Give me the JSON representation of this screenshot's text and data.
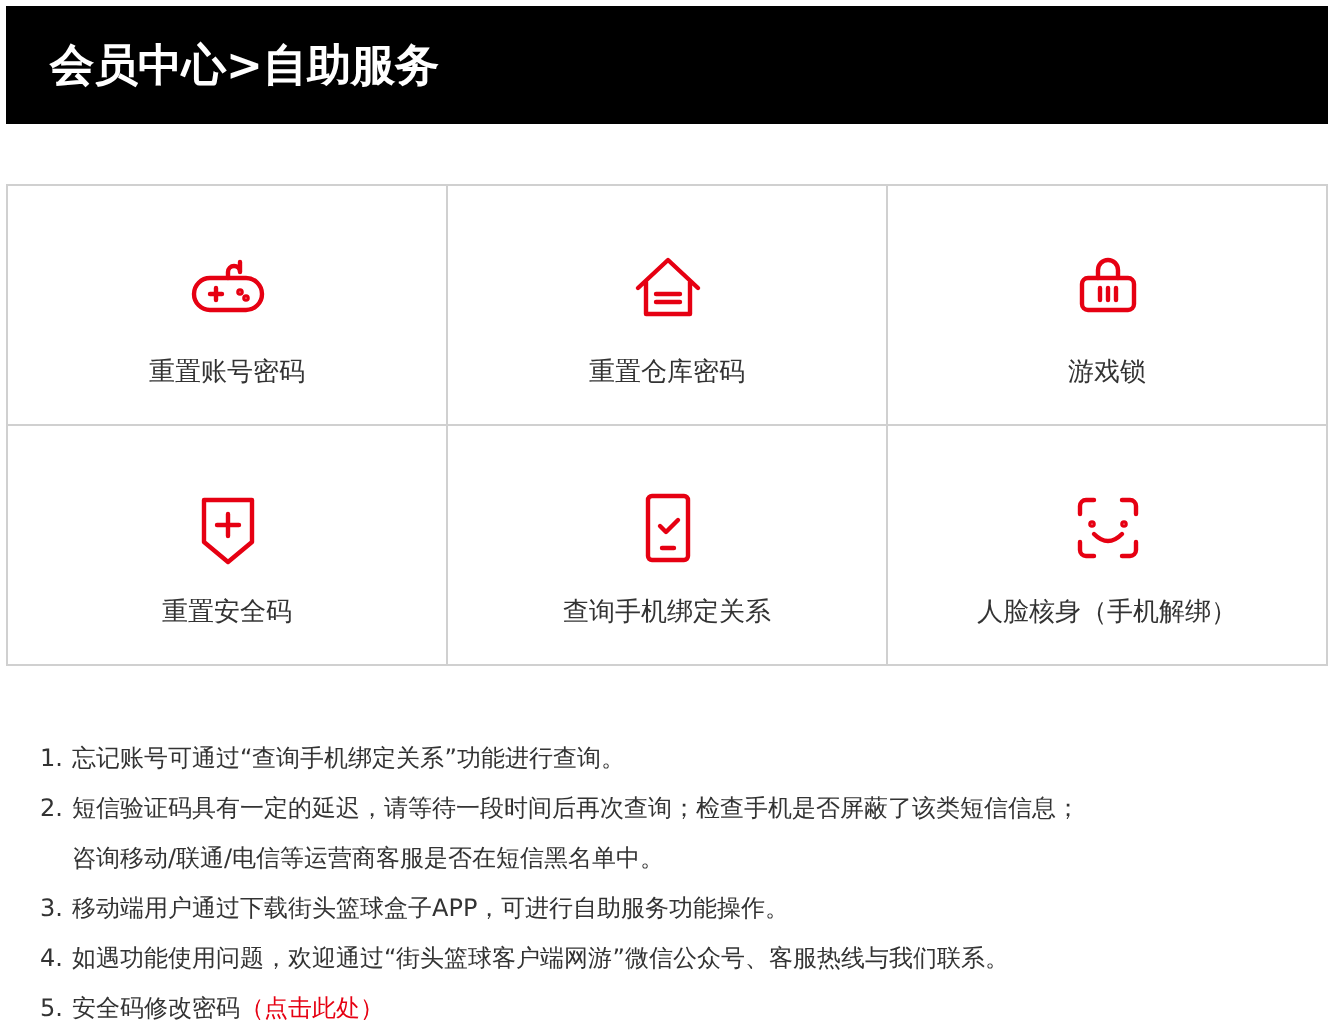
{
  "header": {
    "title": "会员中心>自助服务"
  },
  "tiles": [
    {
      "label": "重置账号密码"
    },
    {
      "label": "重置仓库密码"
    },
    {
      "label": "游戏锁"
    },
    {
      "label": "重置安全码"
    },
    {
      "label": "查询手机绑定关系"
    },
    {
      "label": "人脸核身（手机解绑）"
    }
  ],
  "notes": [
    {
      "number": "1.",
      "lines": [
        "忘记账号可通过“查询手机绑定关系”功能进行查询。"
      ]
    },
    {
      "number": "2.",
      "lines": [
        "短信验证码具有一定的延迟，请等待一段时间后再次查询；检查手机是否屏蔽了该类短信信息；",
        "咨询移动/联通/电信等运营商客服是否在短信黑名单中。"
      ]
    },
    {
      "number": "3.",
      "lines": [
        "移动端用户通过下载街头篮球盒子APP，可进行自助服务功能操作。"
      ]
    },
    {
      "number": "4.",
      "lines": [
        "如遇功能使用问题，欢迎通过“街头篮球客户端网游”微信公众号、客服热线与我们联系。"
      ]
    },
    {
      "number": "5.",
      "lines": [
        "安全码修改密码"
      ],
      "link": "（点击此处）"
    }
  ]
}
